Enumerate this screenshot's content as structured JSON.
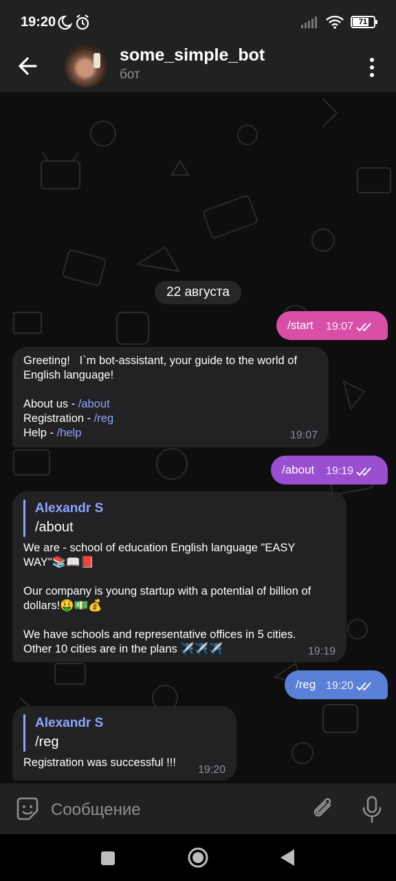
{
  "status": {
    "time": "19:20",
    "battery": "71"
  },
  "header": {
    "title": "some_simple_bot",
    "subtitle": "бот"
  },
  "chat": {
    "date": "22 августа",
    "messages": [
      {
        "kind": "outgoing",
        "text": "/start",
        "time": "19:07",
        "color": "#d94fa8"
      },
      {
        "kind": "incoming",
        "time": "19:07",
        "lines": [
          "Greeting!   I`m bot-assistant, your guide to the world of",
          "English language!",
          "",
          "About us - ",
          "Registration - ",
          "Help - "
        ],
        "links": [
          "/about",
          "/reg",
          "/help"
        ]
      },
      {
        "kind": "outgoing",
        "text": "/about",
        "time": "19:19",
        "color": "#9a4fd0"
      },
      {
        "kind": "incoming",
        "time": "19:19",
        "reply": {
          "author": "Alexandr S",
          "text": "/about"
        },
        "lines": [
          "We are - school of education English language \"EASY",
          "WAY\"📚📖📕",
          "",
          "Our company is young startup with a potential of billion of",
          "dollars!🤑💵💰",
          "",
          "We have schools and representative offices in 5 cities.",
          "Other 10 cities are in the plans ✈️✈️✈️"
        ]
      },
      {
        "kind": "outgoing",
        "text": "/reg",
        "time": "19:20",
        "color": "#5a7fd6"
      },
      {
        "kind": "incoming",
        "time": "19:20",
        "reply": {
          "author": "Alexandr S",
          "text": "/reg"
        },
        "lines": [
          "Registration was successful !!!"
        ]
      }
    ]
  },
  "input": {
    "placeholder": "Сообщение"
  },
  "icons": {
    "back": "arrow-left-icon",
    "menu": "more-vertical-icon",
    "emoji": "sticker-smile-icon",
    "attach": "paperclip-icon",
    "mic": "microphone-icon",
    "read": "double-check-icon"
  }
}
